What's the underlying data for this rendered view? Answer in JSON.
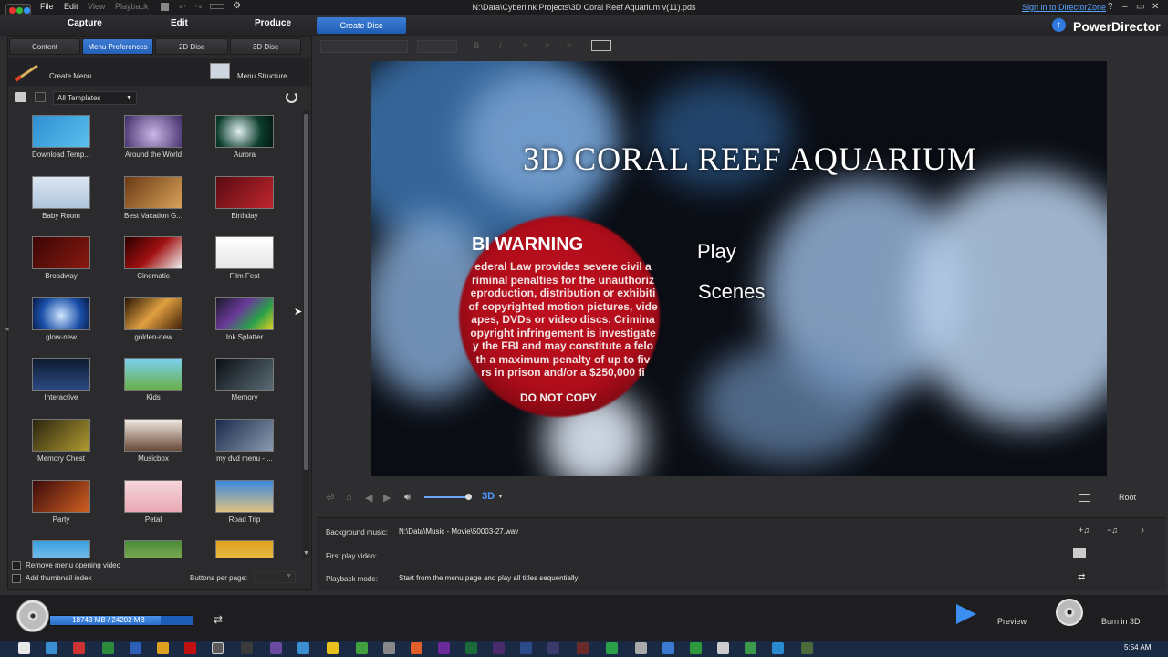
{
  "menubar": {
    "file": "File",
    "edit": "Edit",
    "view": "View",
    "playback": "Playback"
  },
  "window": {
    "title": "N:\\Data\\Cyberlink Projects\\3D Coral Reef Aquarium v(11).pds",
    "sign_in": "Sign in to DirectorZone",
    "help": "?",
    "minimize": "–",
    "maximize": "▭",
    "close": "✕"
  },
  "modes": {
    "capture": "Capture",
    "edit": "Edit",
    "produce": "Produce",
    "create_disc": "Create Disc",
    "brand": "PowerDirector"
  },
  "left_tabs": [
    "Content",
    "Menu Preferences",
    "2D Disc",
    "3D Disc"
  ],
  "left_tools": {
    "create_menu": "Create Menu",
    "menu_structure": "Menu Structure",
    "filter": "All Templates"
  },
  "templates": [
    {
      "name": "Download Temp...",
      "bg": "linear-gradient(135deg,#2f8fd1,#5bc0ef)"
    },
    {
      "name": "Around the World",
      "bg": "radial-gradient(circle at 50% 60%,#c9b7e6,#3e2a66)"
    },
    {
      "name": "Aurora",
      "bg": "radial-gradient(circle at 40% 50%,#e0f0f0,#0c3c2c 60%,#031810)"
    },
    {
      "name": "Baby Room",
      "bg": "linear-gradient(#dbe6f2,#b0c6de)"
    },
    {
      "name": "Best Vacation G...",
      "bg": "linear-gradient(135deg,#6b3a14,#d8a25a)"
    },
    {
      "name": "Birthday",
      "bg": "linear-gradient(135deg,#5a0a12,#c0262e)"
    },
    {
      "name": "Broadway",
      "bg": "linear-gradient(135deg,#3a0606,#8a1a10)"
    },
    {
      "name": "Cinematic",
      "bg": "linear-gradient(135deg,#2a0000,#a01010 50%,#f0f0f0)"
    },
    {
      "name": "Film Fest",
      "bg": "linear-gradient(#ffffff,#e6e6e6)"
    },
    {
      "name": "glow-new",
      "bg": "radial-gradient(circle at 50% 55%,#cfe6ff,#1a4fa8 60%,#081a40)"
    },
    {
      "name": "golden-new",
      "bg": "linear-gradient(135deg,#2a1606,#e0a040 50%,#402008)"
    },
    {
      "name": "Ink Splatter",
      "bg": "linear-gradient(135deg,#1a1a2a,#6a3a9a 40%,#2aa04a 70%,#e0d020)"
    },
    {
      "name": "Interactive",
      "bg": "linear-gradient(#0e1a30,#2a4a80)"
    },
    {
      "name": "Kids",
      "bg": "linear-gradient(#7ad0f0,#6ab04a)"
    },
    {
      "name": "Memory",
      "bg": "linear-gradient(135deg,#0a1014,#5a6a74)"
    },
    {
      "name": "Memory Chest",
      "bg": "linear-gradient(135deg,#2a2410,#b09a30)"
    },
    {
      "name": "Musicbox",
      "bg": "linear-gradient(#f0e8e0,#6a4a3a)"
    },
    {
      "name": "my dvd menu - ...",
      "bg": "linear-gradient(135deg,#1a2a4a,#8a9ab0)"
    },
    {
      "name": "Party",
      "bg": "linear-gradient(135deg,#3a0a0a,#d06020)"
    },
    {
      "name": "Petal",
      "bg": "linear-gradient(#f6d6dc,#e8a8b4)"
    },
    {
      "name": "Road Trip",
      "bg": "linear-gradient(#3a8ae0,#e0c080)"
    },
    {
      "name": "",
      "bg": "linear-gradient(#3aa0e0,#a0d0f0)"
    },
    {
      "name": "",
      "bg": "linear-gradient(#4a8a3a,#a0c060)"
    },
    {
      "name": "",
      "bg": "linear-gradient(#e0a020,#f0d060)"
    }
  ],
  "left_options": {
    "remove_video": "Remove menu opening video",
    "add_index": "Add thumbnail index",
    "buttons_per_page": "Buttons per page:"
  },
  "preview": {
    "title": "3D CORAL REEF AQUARIUM",
    "warning_title": "BI WARNING",
    "warning_body": "ederal Law provides severe civil a\nriminal penalties for the unauthoriz\neproduction, distribution or exhibiti\nof copyrighted motion pictures, vide\napes, DVDs or video discs. Crimina\nopyright infringement is investigate\ny the FBI and may constitute a felo\nth a maximum penalty of up to fiv\nrs in prison and/or a $250,000 fi",
    "do_not_copy": "DO NOT COPY",
    "items": [
      "Play",
      "Scenes"
    ]
  },
  "controls": {
    "mode_3d": "3D",
    "root": "Root"
  },
  "properties": {
    "bg_music_label": "Background music:",
    "bg_music_value": "N:\\Data\\Music - Movie\\50003-27.wav",
    "first_play_label": "First play video:",
    "first_play_value": "",
    "playback_mode_label": "Playback mode:",
    "playback_mode_value": "Start from the menu page and play all titles sequentially"
  },
  "bottom": {
    "space": "18743 MB / 24202 MB",
    "space_fraction": 0.774,
    "preview": "Preview",
    "burn": "Burn in 3D"
  },
  "taskbar": {
    "clock": "5:54 AM"
  }
}
